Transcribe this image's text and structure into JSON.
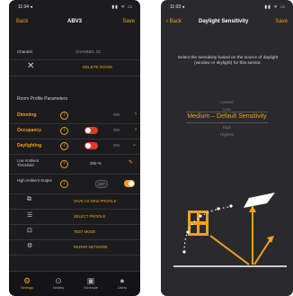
{
  "left_screen": {
    "status": {
      "time": "11:04 ◂",
      "icons": "▮▮ ᯤ ▭"
    },
    "nav": {
      "back": "Back",
      "title": "ABV3",
      "save": "Save"
    },
    "channel": {
      "label": "Channel",
      "value": "CHANNEL 15"
    },
    "delete_label": "DELETE ROOM",
    "section_title": "Room Profile Parameters",
    "params": [
      {
        "label": "Dimming",
        "state": "ON"
      },
      {
        "label": "Occupancy",
        "state": "ON"
      },
      {
        "label": "Daylighting",
        "state": "ON"
      }
    ],
    "low_ambient": {
      "label": "Low Ambient Threshold",
      "value": "250 %"
    },
    "high_ambient": {
      "label": "High Ambient Output",
      "value": "OFF"
    },
    "actions": [
      "SAVE AS NEW PROFILE",
      "SELECT PROFILE",
      "TEST MODE",
      "REPAIR NETWORK"
    ],
    "tabs": [
      {
        "label": "Settings",
        "icon": "gear-icon"
      },
      {
        "label": "Nearby",
        "icon": "location-icon"
      },
      {
        "label": "Schedule",
        "icon": "schedule-icon"
      },
      {
        "label": "Users",
        "icon": "user-icon"
      }
    ]
  },
  "right_screen": {
    "status": {
      "time": "11:03 ◂",
      "icons": "▮▮ ᯤ ▭"
    },
    "nav": {
      "back": "Back",
      "title": "Daylight Sensitivity",
      "save": "Save"
    },
    "instruction": "Select the sensitivity based on the source of daylight (window or skylight) for this sensor.",
    "levels": [
      "Lowest",
      "Low",
      "Medium – Default Sensitivity",
      "High",
      "Highest"
    ],
    "selected_index": 2
  },
  "colors": {
    "accent": "#f0a020",
    "background": "#1c1c1e",
    "toggle_on": "#e03a2a"
  }
}
